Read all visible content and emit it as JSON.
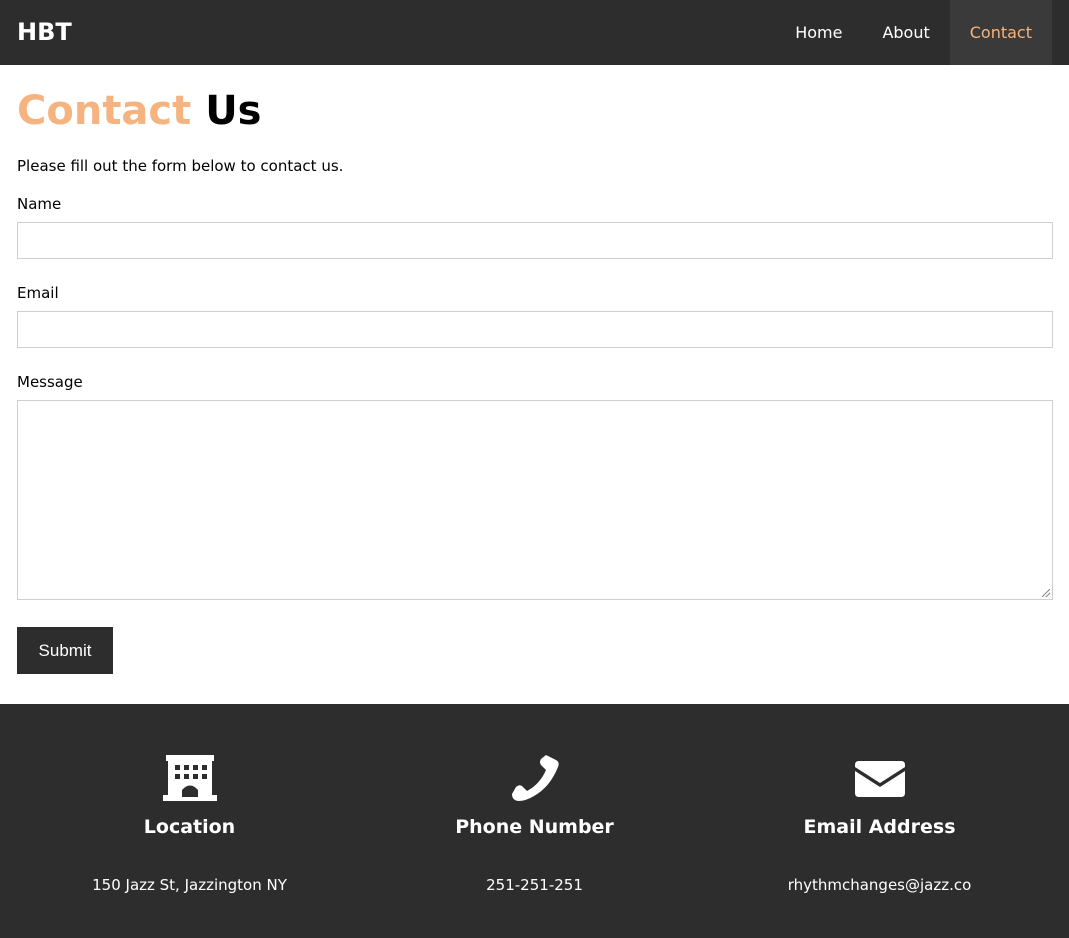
{
  "nav": {
    "brand": "HBT",
    "links": [
      {
        "label": "Home"
      },
      {
        "label": "About"
      },
      {
        "label": "Contact"
      }
    ],
    "active_color": "#f5b47f",
    "background": "#2d2d2d"
  },
  "page": {
    "title_accent": "Contact",
    "title_rest": "Us",
    "intro": "Please fill out the form below to contact us."
  },
  "form": {
    "name_label": "Name",
    "name_value": "",
    "email_label": "Email",
    "email_value": "",
    "message_label": "Message",
    "message_value": "",
    "submit_label": "Submit"
  },
  "footer": {
    "columns": [
      {
        "icon": "building-icon",
        "title": "Location",
        "value": "150 Jazz St, Jazzington NY"
      },
      {
        "icon": "phone-icon",
        "title": "Phone Number",
        "value": "251-251-251"
      },
      {
        "icon": "envelope-icon",
        "title": "Email Address",
        "value": "rhythmchanges@jazz.co"
      }
    ]
  }
}
